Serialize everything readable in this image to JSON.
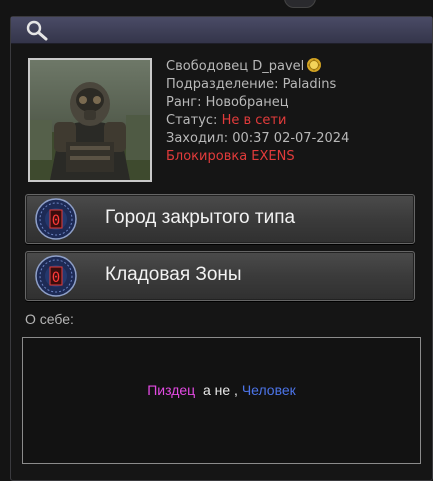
{
  "profile": {
    "name": "Свободовец D_pavel",
    "division": "Подразделение: Paladins",
    "rank": "Ранг: Новобранец",
    "status_label": "Статус:",
    "status_value": "Не в сети",
    "last_seen": "Заходил: 00:37 02-07-2024",
    "block": "Блокировка EXENS"
  },
  "groups": [
    {
      "label": "Город закрытого типа",
      "emblem_value": "0"
    },
    {
      "label": "Кладовая Зоны",
      "emblem_value": "0"
    }
  ],
  "about": {
    "label": "О себе:",
    "word1": "Пиздец",
    "word2": "а не ,",
    "word3": "Человек"
  },
  "colors": {
    "header": "#34354a",
    "status_offline": "#e23b3b",
    "about_word1": "#e24ae2",
    "about_word3": "#4c74e8"
  },
  "icons": {
    "search": "search-icon",
    "rank_badge": "rank-badge-icon",
    "group_emblem": "group-emblem-icon"
  }
}
